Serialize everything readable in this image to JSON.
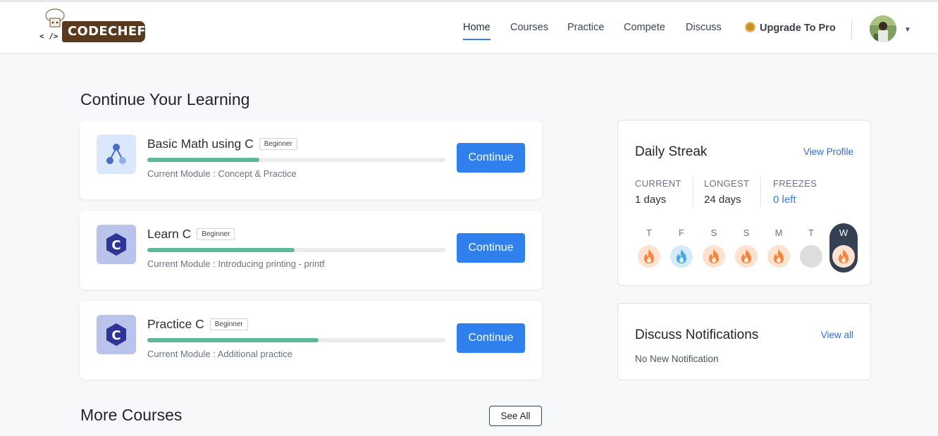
{
  "brand": {
    "name": "CODECHEF",
    "brackets": "<  />"
  },
  "nav": {
    "items": [
      {
        "label": "Home",
        "active": true
      },
      {
        "label": "Courses",
        "active": false
      },
      {
        "label": "Practice",
        "active": false
      },
      {
        "label": "Compete",
        "active": false
      },
      {
        "label": "Discuss",
        "active": false
      }
    ],
    "upgrade_label": "Upgrade To Pro"
  },
  "continue_learning": {
    "title": "Continue Your Learning",
    "courses": [
      {
        "name": "Basic Math using C",
        "level": "Beginner",
        "module": "Current Module : Concept & Practice",
        "progress": 0.375,
        "button": "Continue",
        "icon": "graph-nodes-icon"
      },
      {
        "name": "Learn C",
        "level": "Beginner",
        "module": "Current Module : Introducing printing - printf",
        "progress": 0.495,
        "button": "Continue",
        "icon": "c-language-icon"
      },
      {
        "name": "Practice C",
        "level": "Beginner",
        "module": "Current Module : Additional practice",
        "progress": 0.575,
        "button": "Continue",
        "icon": "c-language-icon"
      }
    ]
  },
  "streak": {
    "title": "Daily Streak",
    "link": "View Profile",
    "current_label": "CURRENT",
    "current_value": "1 days",
    "longest_label": "LONGEST",
    "longest_value": "24 days",
    "freezes_label": "FREEZES",
    "freezes_value": "0 left",
    "days": [
      {
        "letter": "T",
        "state": "fire"
      },
      {
        "letter": "F",
        "state": "freeze"
      },
      {
        "letter": "S",
        "state": "fire"
      },
      {
        "letter": "S",
        "state": "fire"
      },
      {
        "letter": "M",
        "state": "fire"
      },
      {
        "letter": "T",
        "state": "none"
      },
      {
        "letter": "W",
        "state": "fire-today"
      }
    ]
  },
  "notifications": {
    "title": "Discuss Notifications",
    "link": "View all",
    "empty_text": "No New Notification"
  },
  "more_courses": {
    "title": "More Courses",
    "see_all": "See All"
  },
  "colors": {
    "primary": "#2f80ed",
    "progress": "#5db89a",
    "fire": "#f5853f",
    "freeze": "#4aa8e0"
  }
}
